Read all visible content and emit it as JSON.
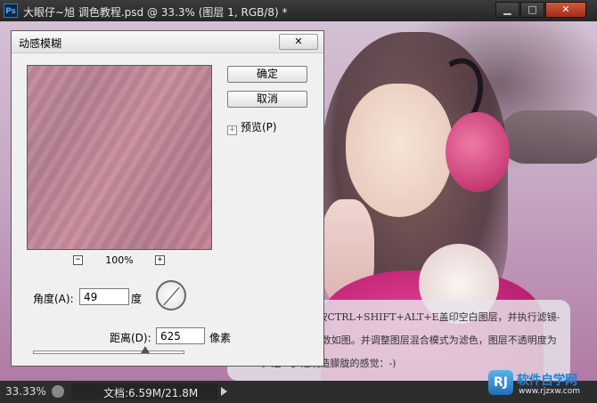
{
  "window": {
    "title": "大眼仔~旭 调色教程.psd @ 33.3% (图层 1, RGB/8) *",
    "app_icon": "Ps",
    "buttons": {
      "minimize": "▁",
      "maximize": "□",
      "close": "✕"
    }
  },
  "dialog": {
    "title": "动感模糊",
    "close_label": "✕",
    "ok_label": "确定",
    "cancel_label": "取消",
    "preview_label": "预览(P)",
    "zoom_minus": "−",
    "zoom_plus": "+",
    "zoom_value": "100%",
    "angle_label": "角度(A):",
    "angle_value": "49",
    "angle_unit": "度",
    "distance_label": "距离(D):",
    "distance_value": "625",
    "distance_unit": "像素"
  },
  "caption": {
    "text": "6.新建空白图层，按CTRL+SHIFT+ALT+E盖印空白图层，并执行滤镜-模糊-动感模糊，参数如图。并调整图层混合模式为滤色，图层不透明度为50%。这一步是制造朦胧的感觉：-)"
  },
  "statusbar": {
    "zoom": "33.33%",
    "doc_info": "文档:6.59M/21.8M"
  },
  "watermark": {
    "logo": "RJ",
    "text": "软件自学网",
    "url": "www.rjzxw.com"
  }
}
